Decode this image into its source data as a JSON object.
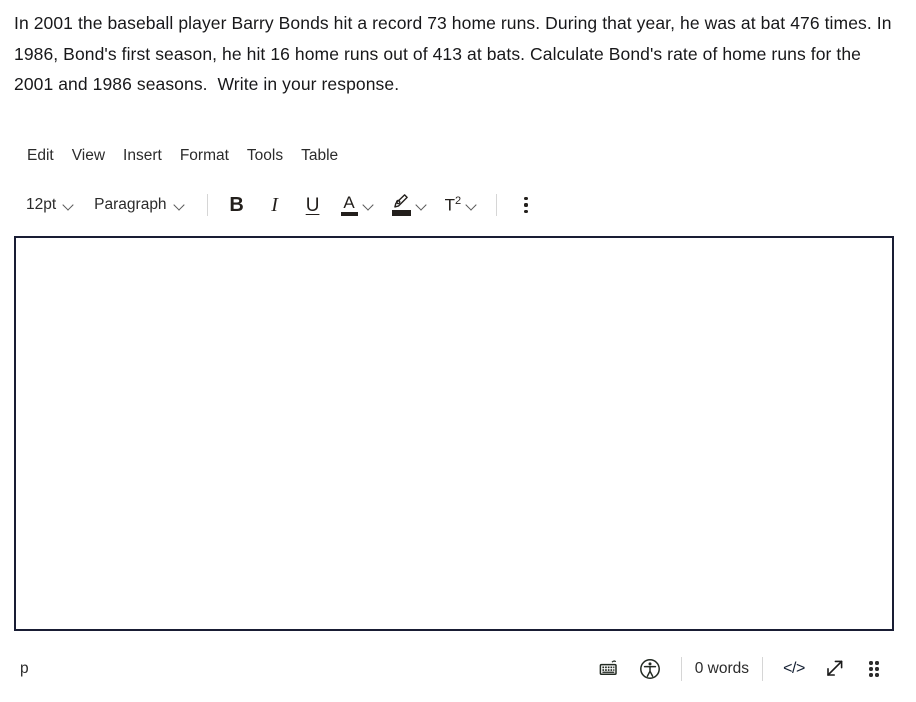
{
  "question": {
    "text": "In 2001 the baseball player Barry Bonds hit a record 73 home runs. During that year, he was at bat 476 times. In 1986, Bond's first season, he hit 16 home runs out of 413 at bats. Calculate Bond's rate of home runs for the 2001 and 1986 seasons.  Write in your response."
  },
  "menubar": {
    "items": [
      {
        "label": "Edit",
        "name": "menu-edit"
      },
      {
        "label": "View",
        "name": "menu-view"
      },
      {
        "label": "Insert",
        "name": "menu-insert"
      },
      {
        "label": "Format",
        "name": "menu-format"
      },
      {
        "label": "Tools",
        "name": "menu-tools"
      },
      {
        "label": "Table",
        "name": "menu-table"
      }
    ]
  },
  "toolbar": {
    "fontsize_value": "12pt",
    "blockformat_value": "Paragraph",
    "bold_label": "B",
    "italic_label": "I",
    "underline_label": "U",
    "textcolor_label": "A",
    "superscript_label": "T",
    "superscript_exponent": "2",
    "more_label": "",
    "icons": {
      "fontsize_chevron": "chevron-down-icon",
      "blockformat_chevron": "chevron-down-icon",
      "textcolor": "text-color-icon",
      "highlight": "highlight-color-icon",
      "superscript": "superscript-icon",
      "more": "more-options-icon"
    }
  },
  "editor": {
    "content": "",
    "placeholder": ""
  },
  "statusbar": {
    "element_path": "p",
    "word_count": "0 words",
    "code_label": "</>",
    "icons": {
      "keyboard": "keyboard-icon",
      "accessibility": "accessibility-icon",
      "source_code": "source-code-icon",
      "resize": "resize-handle-icon",
      "drag": "drag-handle-icon"
    }
  },
  "colors": {
    "editor_border": "#191d34",
    "text": "#18181a",
    "separator": "#d6d6d6",
    "icon": "#231f1c"
  }
}
